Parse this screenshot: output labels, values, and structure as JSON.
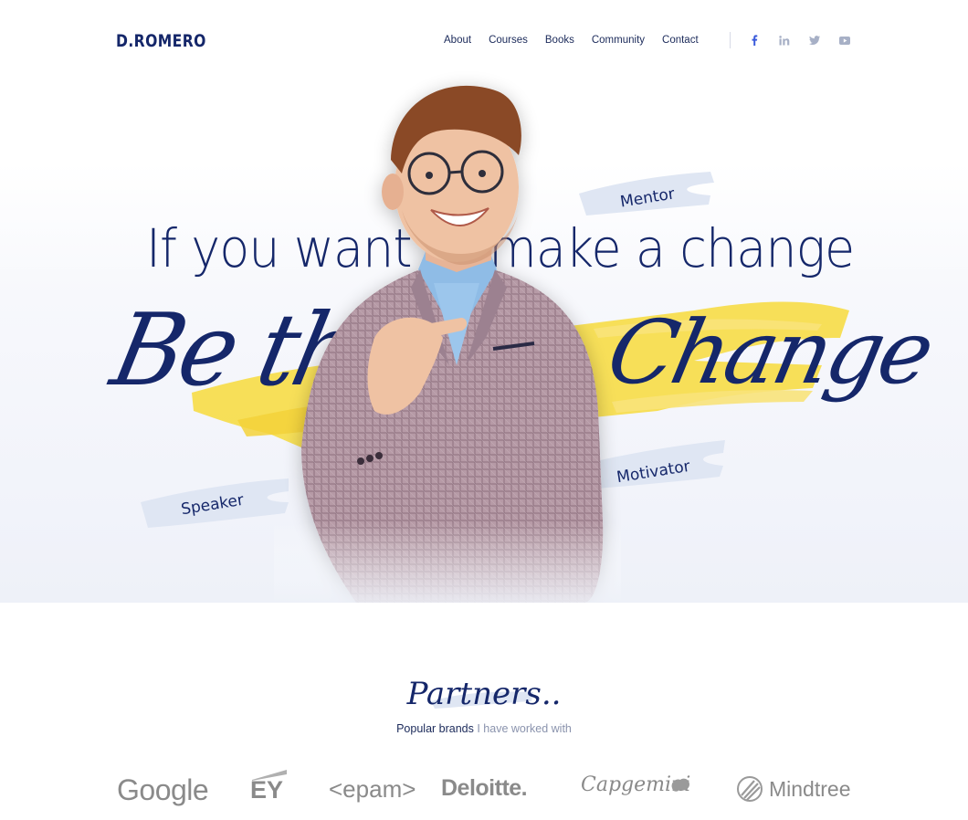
{
  "header": {
    "logo": "D.ROMERO",
    "nav": [
      {
        "label": "About"
      },
      {
        "label": "Courses"
      },
      {
        "label": "Books"
      },
      {
        "label": "Community"
      },
      {
        "label": "Contact"
      }
    ],
    "social": [
      {
        "icon": "facebook-icon",
        "color": "#3b5bdb"
      },
      {
        "icon": "linkedin-icon",
        "color": "#a7b0c6"
      },
      {
        "icon": "twitter-icon",
        "color": "#a7b0c6"
      },
      {
        "icon": "youtube-icon",
        "color": "#a7b0c6"
      }
    ]
  },
  "hero": {
    "headline": "If you want to make a change",
    "script_left": "Be the",
    "script_right": "Change",
    "tags": {
      "mentor": "Mentor",
      "speaker": "Speaker",
      "motivator": "Motivator"
    },
    "accent_color": "#f6dc4a",
    "text_color": "#15276a"
  },
  "partners": {
    "title": "Partners..",
    "subtitle_strong": "Popular brands",
    "subtitle_muted": "I have worked with",
    "brands": [
      "Google",
      "EY",
      "<epam>",
      "Deloitte.",
      "Capgemini",
      "Mindtree"
    ]
  }
}
